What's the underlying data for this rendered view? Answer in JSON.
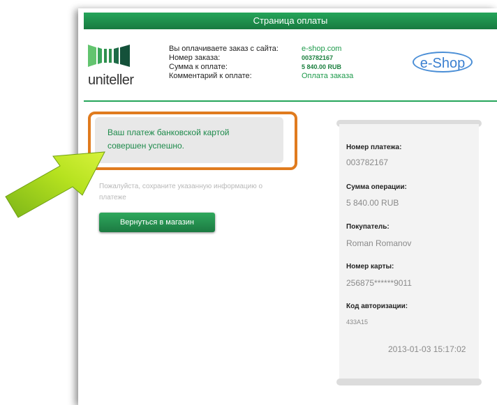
{
  "header": {
    "title": "Страница оплаты"
  },
  "logo": {
    "text": "uniteller"
  },
  "order_info": {
    "labels": [
      "Вы оплачиваете заказ с сайта:",
      "Номер заказа:",
      "Сумма к оплате:",
      "Комментарий к оплате:"
    ],
    "values": [
      "e-shop.com",
      "003782167",
      "5 840.00 RUB",
      "Оплата заказа"
    ]
  },
  "merchant_logo": {
    "text": "e-Shop"
  },
  "result": {
    "message": "Ваш платеж банковской картой совершен успешно.",
    "note": "Пожалуйста, сохраните указанную информацию о платеже",
    "back_button": "Вернуться в магазин"
  },
  "receipt": {
    "payment_number_label": "Номер платежа:",
    "payment_number": "003782167",
    "amount_label": "Сумма операции:",
    "amount": "5 840.00 RUB",
    "buyer_label": "Покупатель:",
    "buyer": "Roman Romanov",
    "card_label": "Номер карты:",
    "card": "256875******9011",
    "auth_label": "Код авторизации:",
    "auth_code": "433A15",
    "datetime": "2013-01-03 15:17:02"
  },
  "colors": {
    "brand_green": "#1e8a4b",
    "highlight_orange": "#e07b1e",
    "eshop_blue": "#3a7fd0"
  }
}
